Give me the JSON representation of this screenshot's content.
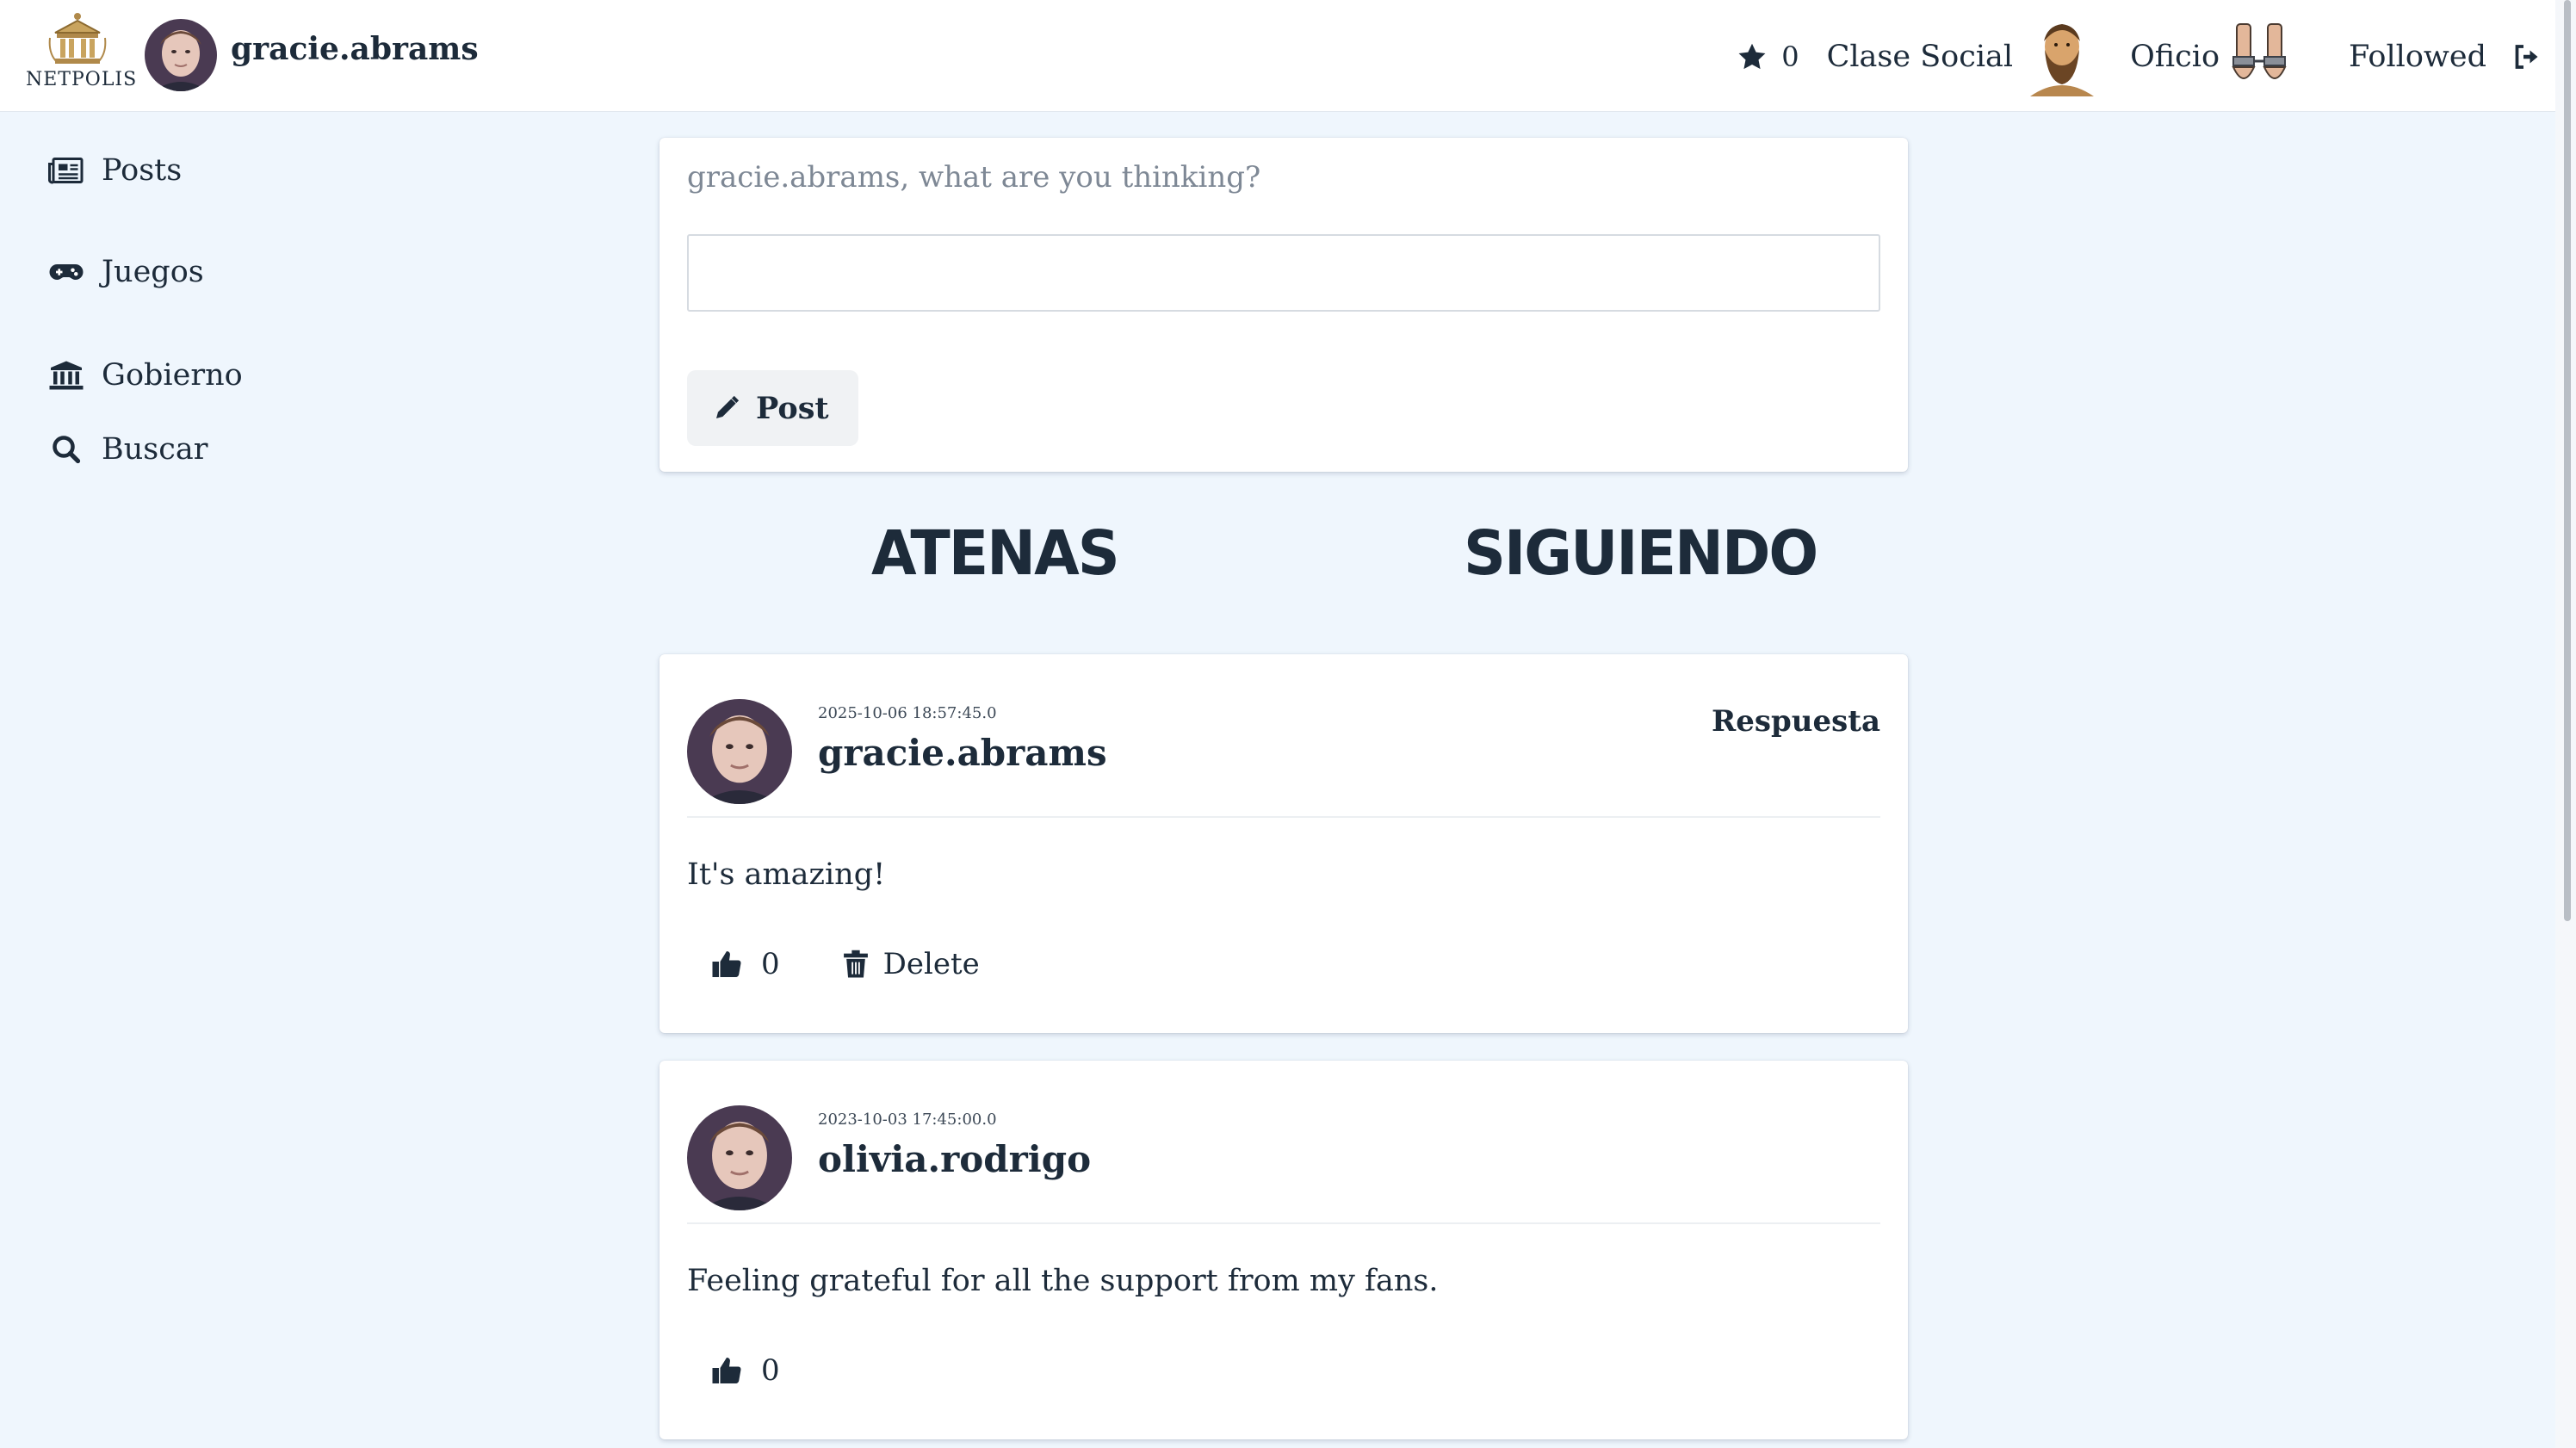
{
  "app": {
    "logo_text": "NETPOLIS"
  },
  "header": {
    "username": "gracie.abrams",
    "star_count": "0",
    "clase_social_label": "Clase Social",
    "oficio_label": "Oficio",
    "followed_label": "Followed",
    "icons": [
      "star-icon",
      "bearded-man-icon",
      "shackled-hands-icon",
      "logout-icon"
    ]
  },
  "sidebar": {
    "items": [
      {
        "label": "Posts",
        "icon": "newspaper-icon"
      },
      {
        "label": "Juegos",
        "icon": "gamepad-icon"
      },
      {
        "label": "Gobierno",
        "icon": "government-building-icon"
      },
      {
        "label": "Buscar",
        "icon": "search-icon"
      }
    ]
  },
  "composer": {
    "prompt": "gracie.abrams, what are you thinking?",
    "value": "",
    "post_label": "Post"
  },
  "tabs": [
    "ATENAS",
    "SIGUIENDO"
  ],
  "posts": [
    {
      "timestamp": "2025-10-06 18:57:45.0",
      "author": "gracie.abrams",
      "reply_label": "Respuesta",
      "text": "It's amazing!",
      "likes": "0",
      "delete_label": "Delete"
    },
    {
      "timestamp": "2023-10-03 17:45:00.0",
      "author": "olivia.rodrigo",
      "text": "Feeling grateful for all the support from my fans.",
      "likes": "0"
    }
  ],
  "colors": {
    "background": "#eff6fd",
    "text": "#1d2b3a",
    "card": "#ffffff",
    "button": "#f0f2f4"
  }
}
